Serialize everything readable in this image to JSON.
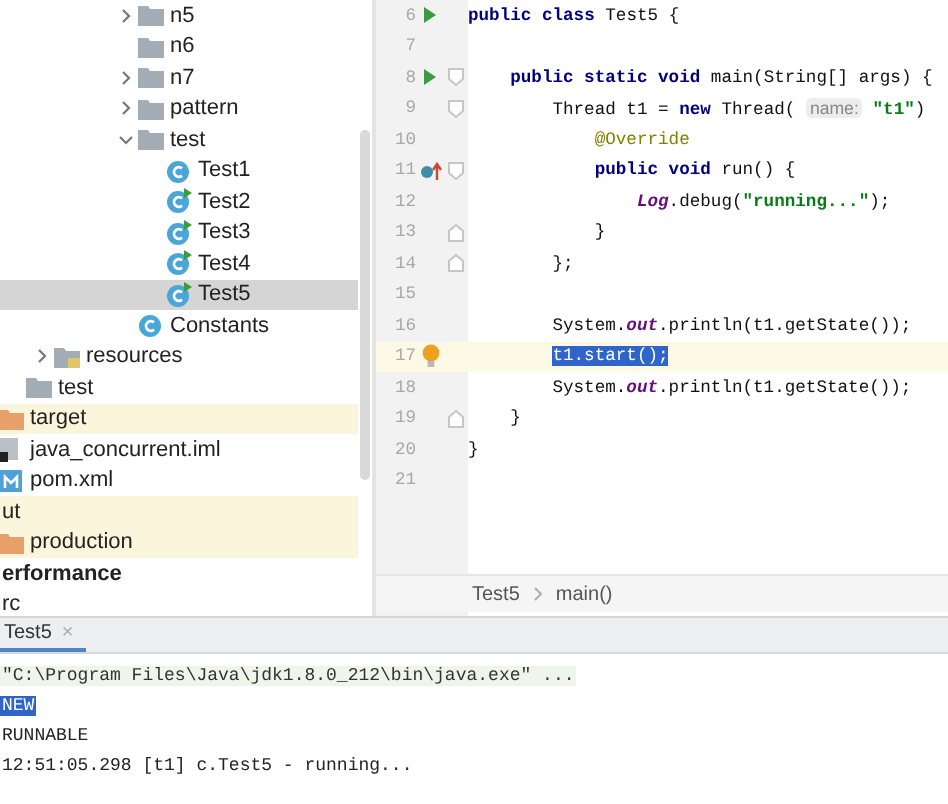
{
  "project_tree": [
    {
      "children": [
        {
          "children": [
            {
              "children": [
                {
                  "children": [
                    {
                      "children": [
                        {
                          "children": [
                            {
                              "label": "n5",
                              "kind": "folder",
                              "expanded": false,
                              "selected": false
                            },
                            {
                              "label": "n6",
                              "kind": "folder",
                              "selected": false
                            },
                            {
                              "label": "n7",
                              "kind": "folder",
                              "expanded": false,
                              "selected": false
                            },
                            {
                              "label": "pattern",
                              "kind": "folder",
                              "expanded": false,
                              "selected": false
                            },
                            {
                              "label": "test",
                              "kind": "folder",
                              "expanded": true,
                              "selected": false,
                              "children": [
                                {
                                  "label": "Test1",
                                  "kind": "class",
                                  "selected": false
                                },
                                {
                                  "label": "Test2",
                                  "kind": "main-class",
                                  "selected": false
                                },
                                {
                                  "label": "Test3",
                                  "kind": "main-class",
                                  "selected": false
                                },
                                {
                                  "label": "Test4",
                                  "kind": "main-class",
                                  "selected": false
                                },
                                {
                                  "label": "Test5",
                                  "kind": "main-class",
                                  "selected": true
                                }
                              ]
                            },
                            {
                              "label": "Constants",
                              "kind": "class",
                              "selected": false
                            }
                          ]
                        }
                      ]
                    }
                  ]
                },
                {
                  "label": "resources",
                  "kind": "resources",
                  "expanded": false,
                  "selected": false
                }
              ]
            },
            {
              "label": "test",
              "kind": "folder",
              "selected": false
            }
          ]
        },
        {
          "label": "target",
          "kind": "excluded",
          "ignored": true,
          "selected": false
        },
        {
          "label": "java_concurrent.iml",
          "kind": "module-file",
          "selected": false
        },
        {
          "label": "pom.xml",
          "kind": "maven",
          "selected": false
        }
      ]
    },
    {
      "label": "ut",
      "ignored": true,
      "selected": false,
      "children": [
        {
          "label": "production",
          "kind": "excluded",
          "ignored": true,
          "selected": false
        }
      ]
    },
    {
      "label": "erformance",
      "bold": true,
      "selected": false
    },
    {
      "label": "rc",
      "selected": false
    }
  ],
  "editor": {
    "lines": [
      {
        "number": "6",
        "kind": "run",
        "current": false,
        "fold_start": false,
        "fold_end": false,
        "tokens": [
          {
            "text": "public class ",
            "kind": "keyword"
          },
          {
            "text": "Test5 {",
            "kind": "plain"
          }
        ],
        "children": [
          {
            "number": "7",
            "current": false,
            "fold_start": false,
            "fold_end": false
          },
          {
            "number": "8",
            "kind": "run",
            "current": false,
            "fold_start": true,
            "fold_end": false,
            "tokens": [
              {
                "text": "public static void ",
                "kind": "keyword"
              },
              {
                "text": "main(String[] args) {",
                "kind": "plain"
              }
            ],
            "children": [
              {
                "number": "9",
                "current": false,
                "fold_start": true,
                "fold_end": false,
                "tokens": [
                  {
                    "text": "Thread t1 = ",
                    "kind": "plain"
                  },
                  {
                    "text": "new ",
                    "kind": "keyword"
                  },
                  {
                    "text": "Thread( ",
                    "kind": "plain"
                  },
                  {
                    "text": "name:",
                    "kind": "hint"
                  },
                  {
                    "text": "\"t1\"",
                    "kind": "string"
                  },
                  {
                    "text": ")",
                    "kind": "plain"
                  }
                ],
                "children": [
                  {
                    "number": "10",
                    "current": false,
                    "fold_start": false,
                    "fold_end": false,
                    "tokens": [
                      {
                        "text": "@Override",
                        "kind": "annotation"
                      }
                    ]
                  },
                  {
                    "number": "11",
                    "kind": "override",
                    "current": false,
                    "fold_start": true,
                    "fold_end": false,
                    "tokens": [
                      {
                        "text": "public void ",
                        "kind": "keyword"
                      },
                      {
                        "text": "run() {",
                        "kind": "plain"
                      }
                    ],
                    "children": [
                      {
                        "number": "12",
                        "current": false,
                        "fold_start": false,
                        "fold_end": false,
                        "tokens": [
                          {
                            "text": "Log",
                            "kind": "static"
                          },
                          {
                            "text": ".debug(",
                            "kind": "plain"
                          },
                          {
                            "text": "\"running...\"",
                            "kind": "string"
                          },
                          {
                            "text": ");",
                            "kind": "plain"
                          }
                        ]
                      }
                    ]
                  },
                  {
                    "number": "13",
                    "current": false,
                    "fold_start": false,
                    "fold_end": true,
                    "tokens": [
                      {
                        "text": "}",
                        "kind": "plain"
                      }
                    ]
                  }
                ]
              },
              {
                "number": "14",
                "current": false,
                "fold_start": false,
                "fold_end": true,
                "tokens": [
                  {
                    "text": "};",
                    "kind": "plain"
                  }
                ]
              },
              {
                "number": "15",
                "current": false,
                "fold_start": false,
                "fold_end": false
              },
              {
                "number": "16",
                "current": false,
                "fold_start": false,
                "fold_end": false,
                "tokens": [
                  {
                    "text": "System.",
                    "kind": "plain"
                  },
                  {
                    "text": "out",
                    "kind": "static"
                  },
                  {
                    "text": ".println(t1.getState());",
                    "kind": "plain"
                  }
                ]
              },
              {
                "number": "17",
                "kind": "bulb",
                "current": true,
                "fold_start": false,
                "fold_end": false,
                "tokens": [
                  {
                    "text": "t1.start();",
                    "kind": "selection"
                  }
                ]
              },
              {
                "number": "18",
                "current": false,
                "fold_start": false,
                "fold_end": false,
                "tokens": [
                  {
                    "text": "System.",
                    "kind": "plain"
                  },
                  {
                    "text": "out",
                    "kind": "static"
                  },
                  {
                    "text": ".println(t1.getState());",
                    "kind": "plain"
                  }
                ]
              }
            ]
          },
          {
            "number": "19",
            "current": false,
            "fold_start": false,
            "fold_end": true,
            "tokens": [
              {
                "text": "}",
                "kind": "plain"
              }
            ]
          }
        ]
      },
      {
        "number": "20",
        "current": false,
        "fold_start": false,
        "fold_end": false,
        "tokens": [
          {
            "text": "}",
            "kind": "plain"
          }
        ]
      },
      {
        "number": "21",
        "current": false,
        "fold_start": false,
        "fold_end": false
      }
    ],
    "breadcrumb": [
      "Test5",
      "main()"
    ]
  },
  "run_panel": {
    "tabs": [
      {
        "label": "Test5",
        "close": "×",
        "selected": true
      }
    ],
    "console": [
      {
        "text": "\"C:\\Program Files\\Java\\jdk1.8.0_212\\bin\\java.exe\" ...",
        "kind": "command",
        "selected": false
      },
      {
        "text": "NEW",
        "kind": "output",
        "selected": true
      },
      {
        "text": "RUNNABLE",
        "kind": "output",
        "selected": false
      },
      {
        "text": "12:51:05.298 [t1] c.Test5 - running...",
        "kind": "output",
        "selected": false
      }
    ]
  }
}
